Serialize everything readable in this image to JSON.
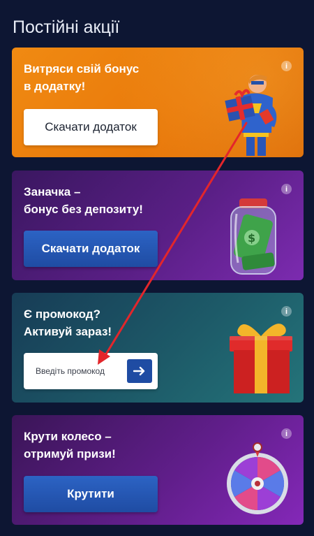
{
  "page": {
    "title": "Постійні акції"
  },
  "promos": [
    {
      "title": "Витряси свій бонус\nв додатку!",
      "button": "Скачати додаток",
      "art": "superhero-gift-image"
    },
    {
      "title": "Заначка –\nбонус без депозиту!",
      "button": "Скачати додаток",
      "art": "money-jar-image"
    },
    {
      "title": "Є промокод?\nАктивуй зараз!",
      "input_placeholder": "Введіть промокод",
      "art": "gift-box-image"
    },
    {
      "title": "Крути колесо –\nотримуй призи!",
      "button": "Крутити",
      "art": "fortune-wheel-image"
    }
  ],
  "info_icon_glyph": "i",
  "colors": {
    "background": "#0d1633",
    "orange_card": "#ec7e0c",
    "purple_card": "#5a1f86",
    "teal_card": "#1d5a68",
    "button_blue": "#1f4ca3",
    "annotation_arrow": "#e3262b"
  }
}
